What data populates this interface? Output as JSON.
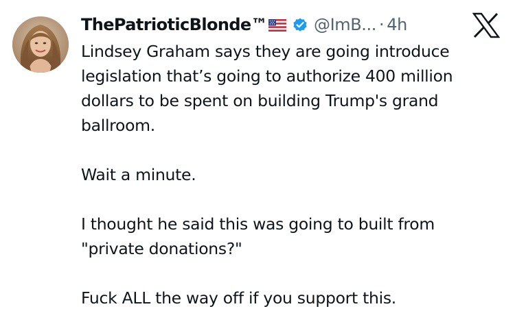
{
  "colors": {
    "text": "#0f1419",
    "secondary": "#536471",
    "verified": "#1d9bf0"
  },
  "author": {
    "display_name": "ThePatrioticBlonde™",
    "flag_icon": "us-flag-icon",
    "verified_icon": "verified-badge-icon",
    "handle": "@ImB...",
    "separator": "·",
    "time": "4h"
  },
  "platform_icon": "x-logo-icon",
  "tweet": {
    "paragraphs": [
      {
        "lines": [
          "Lindsey Graham says they are going introduce",
          "legislation that’s going to authorize 400 million",
          "dollars to be spent on building Trump's grand",
          "ballroom."
        ]
      },
      {
        "lines": [
          "Wait a minute."
        ]
      },
      {
        "lines": [
          "I thought he said this was going to built from",
          "\"private donations?\""
        ]
      },
      {
        "lines": [
          "Fuck ALL the way off if you support this."
        ]
      }
    ]
  }
}
